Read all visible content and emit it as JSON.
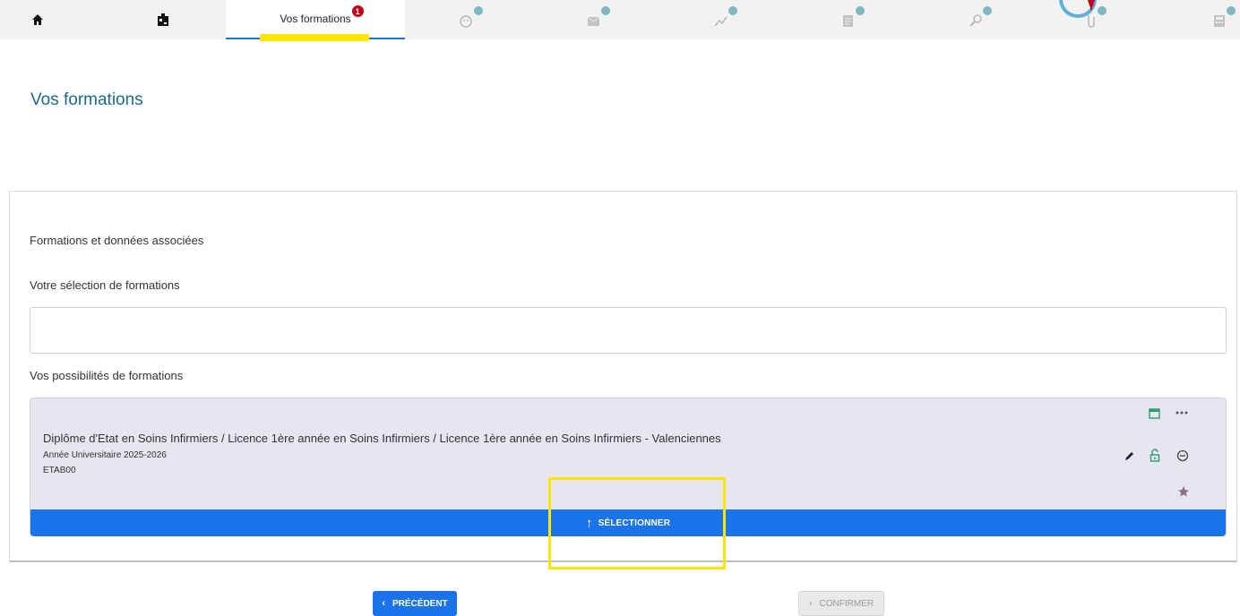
{
  "tabs": {
    "home_icon": "home-icon",
    "id_icon": "id-card-icon",
    "active_label": "Vos formations",
    "active_badge": "1",
    "step_icons": [
      "profile-icon",
      "mail-icon",
      "chart-icon",
      "document-icon",
      "search-icon",
      "attachment-icon",
      "calculator-icon"
    ]
  },
  "page": {
    "title": "Vos formations"
  },
  "panel": {
    "section_label": "Formations et données associées",
    "selection_label": "Votre sélection de formations",
    "possibilities_label": "Vos possibilités de formations"
  },
  "formation": {
    "title": "Diplôme d'Etat en Soins Infirmiers / Licence 1ère année en Soins Infirmiers / Licence 1ère année en Soins Infirmiers - Valenciennes",
    "year": "Année Universitaire 2025-2026",
    "code": "ETAB00",
    "select_label": "SÉLECTIONNER",
    "select_arrow": "↑",
    "icons": [
      "calendar-icon",
      "more-icon",
      "edit-icon",
      "lock-icon",
      "remove-icon",
      "star-icon"
    ]
  },
  "footer": {
    "prev_label": "PRÉCÉDENT",
    "prev_chevron": "‹",
    "next_label": "CONFIRMER",
    "next_chevron": "›"
  },
  "colors": {
    "accent": "#1a73e8",
    "title": "#1b6b86",
    "badge": "#c3001c",
    "highlight": "#ffe600",
    "card_bg": "#e6e6f0",
    "icon_green": "#2e9b6a"
  }
}
